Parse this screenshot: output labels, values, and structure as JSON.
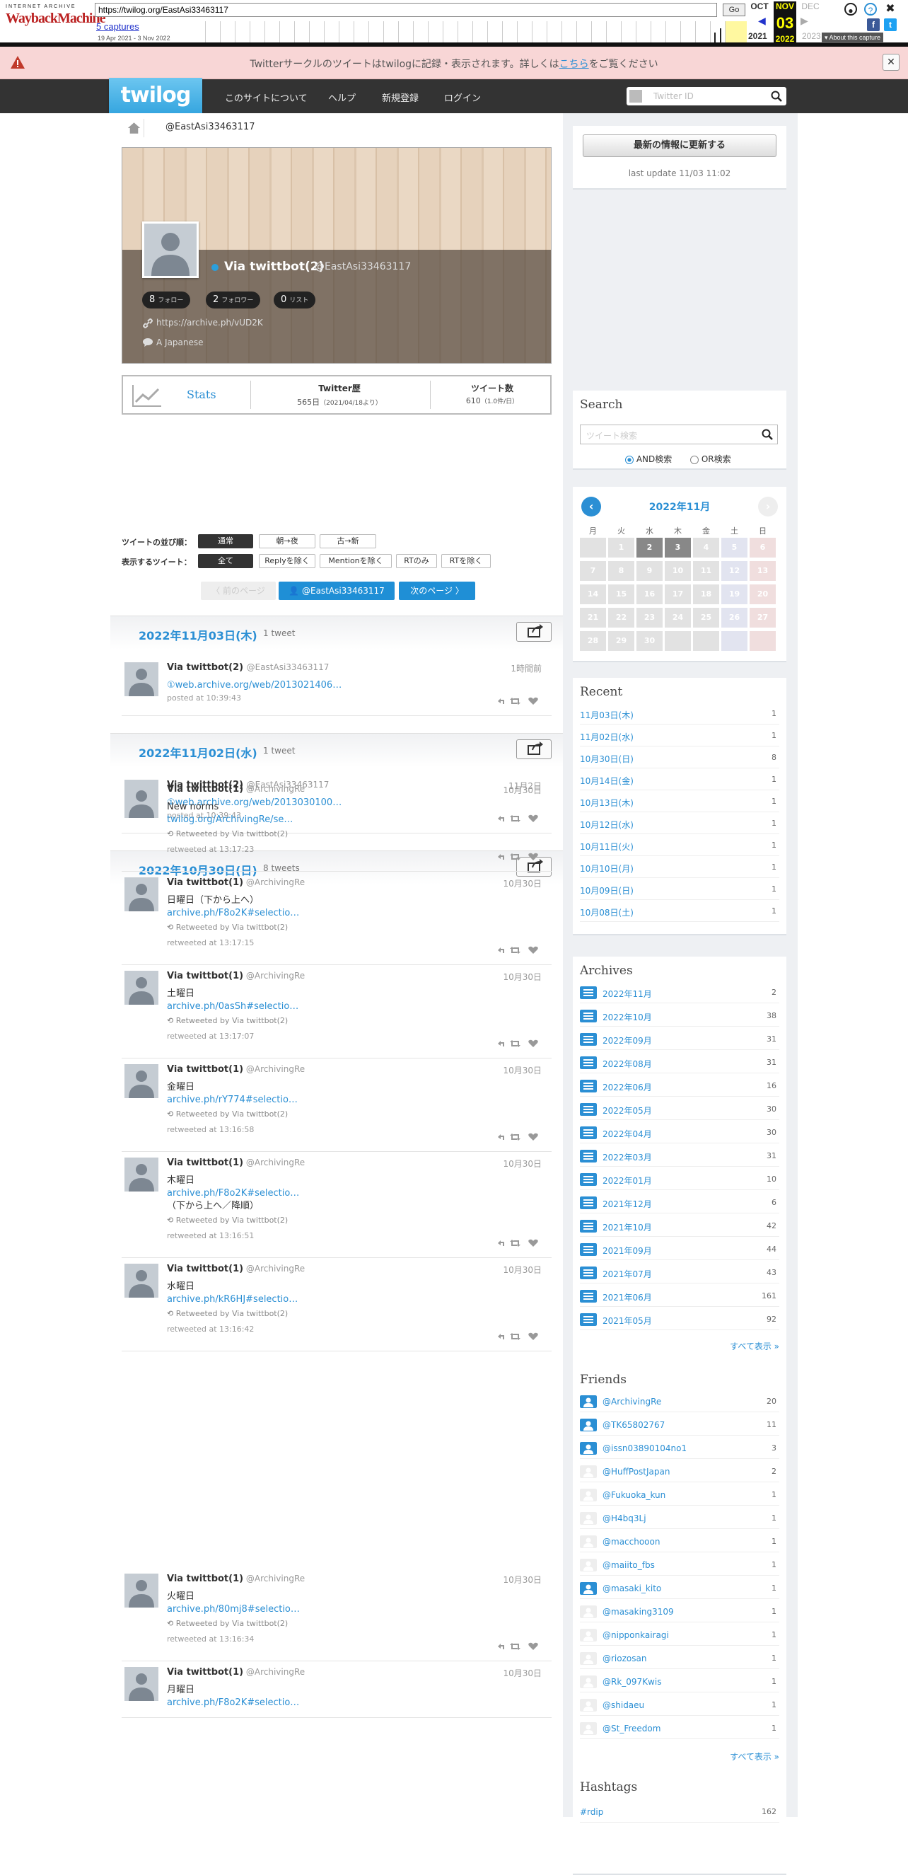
{
  "wayback": {
    "logo_top": "INTERNET ARCHIVE",
    "logo_main": "WaybackMachine",
    "url": "https://twilog.org/EastAsi33463117",
    "go": "Go",
    "captures": "5 captures",
    "range": "19 Apr 2021 - 3 Nov 2022",
    "months": {
      "prev": "OCT",
      "cur": "NOV",
      "next": "DEC"
    },
    "day": "03",
    "years": {
      "prev": "2021",
      "cur": "2022",
      "next": "2023"
    },
    "about": "▾ About this capture"
  },
  "notice": {
    "text": "Twitterサークルのツイートはtwilogに記録・表示されます。詳しくは",
    "link": "こちら",
    "suffix": "をご覧ください",
    "close": "✕"
  },
  "nav": {
    "logo": "twilog",
    "links": [
      "このサイトについて",
      "ヘルプ",
      "新規登録",
      "ログイン"
    ],
    "search_placeholder": "Twitter ID"
  },
  "breadcrumb": {
    "handle": "@EastAsi33463117"
  },
  "profile": {
    "name": "Via twittbot(2)",
    "screen_name": "@EastAsi33463117",
    "pills": [
      {
        "num": "8",
        "label": "フォロー"
      },
      {
        "num": "2",
        "label": "フォロワー"
      },
      {
        "num": "0",
        "label": "リスト"
      }
    ],
    "link": "https://archive.ph/vUD2K",
    "lang": "A Japanese"
  },
  "stats": {
    "label": "Stats",
    "history_head": "Twitter歴",
    "history_val": "565日",
    "history_sub": "（2021/04/18より）",
    "count_head": "ツイート数",
    "count_val": "610",
    "count_sub": "（1.0件/日）"
  },
  "sort": {
    "order_label": "ツイートの並び順：",
    "order_opts": [
      "通常",
      "朝→夜",
      "古→新"
    ],
    "show_label": "表示するツイート：",
    "show_opts": [
      "全て",
      "Replyを除く",
      "Mentionを除く",
      "RTのみ",
      "RTを除く"
    ]
  },
  "pager": {
    "prev": "〈 前のページ",
    "user": "@EastAsi33463117",
    "next": "次のページ 〉"
  },
  "days": [
    {
      "date": "2022年11月03日(木)",
      "count": "1 tweet"
    },
    {
      "date": "2022年11月02日(水)",
      "count": "1 tweet"
    },
    {
      "date": "2022年10月30日(日)",
      "count": "8 tweets"
    }
  ],
  "tweets": [
    {
      "name": "Via twittbot(2)",
      "sn": "@EastAsi33463117",
      "time": "1時間前",
      "text": "",
      "link": "①web.archive.org/web/2013021406…",
      "extra": "",
      "rt": "",
      "meta": "posted at 10:39:43"
    },
    {
      "name": "Via twittbot(2)",
      "sn": "@EastAsi33463117",
      "time": "11月2日",
      "text": "",
      "link": "①web.archive.org/web/2013030100…",
      "extra": "",
      "rt": "",
      "meta": "posted at 10:39:43"
    },
    {
      "name": "Via twittbot(1)",
      "sn": "@ArchivingRe",
      "time": "10月30日",
      "text": "New norms",
      "link": "twilog.org/ArchivingRe/se…",
      "extra": "",
      "rt": "Retweeted by Via twittbot(2)",
      "meta": "retweeted at 13:17:23"
    },
    {
      "name": "Via twittbot(1)",
      "sn": "@ArchivingRe",
      "time": "10月30日",
      "text": "日曜日（下から上へ）",
      "link": "archive.ph/F8o2K#selectio…",
      "extra": "",
      "rt": "Retweeted by Via twittbot(2)",
      "meta": "retweeted at 13:17:15"
    },
    {
      "name": "Via twittbot(1)",
      "sn": "@ArchivingRe",
      "time": "10月30日",
      "text": "土曜日",
      "link": "archive.ph/0asSh#selectio…",
      "extra": "",
      "rt": "Retweeted by Via twittbot(2)",
      "meta": "retweeted at 13:17:07"
    },
    {
      "name": "Via twittbot(1)",
      "sn": "@ArchivingRe",
      "time": "10月30日",
      "text": "金曜日",
      "link": "archive.ph/rY774#selectio…",
      "extra": "",
      "rt": "Retweeted by Via twittbot(2)",
      "meta": "retweeted at 13:16:58"
    },
    {
      "name": "Via twittbot(1)",
      "sn": "@ArchivingRe",
      "time": "10月30日",
      "text": "木曜日",
      "link": "archive.ph/F8o2K#selectio…",
      "extra": "（下から上へ／降順）",
      "rt": "Retweeted by Via twittbot(2)",
      "meta": "retweeted at 13:16:51"
    },
    {
      "name": "Via twittbot(1)",
      "sn": "@ArchivingRe",
      "time": "10月30日",
      "text": "水曜日",
      "link": "archive.ph/kR6HJ#selectio…",
      "extra": "",
      "rt": "Retweeted by Via twittbot(2)",
      "meta": "retweeted at 13:16:42"
    },
    {
      "name": "Via twittbot(1)",
      "sn": "@ArchivingRe",
      "time": "10月30日",
      "text": "火曜日",
      "link": "archive.ph/80mj8#selectio…",
      "extra": "",
      "rt": "Retweeted by Via twittbot(2)",
      "meta": "retweeted at 13:16:34"
    },
    {
      "name": "Via twittbot(1)",
      "sn": "@ArchivingRe",
      "time": "10月30日",
      "text": "月曜日",
      "link": "archive.ph/F8o2K#selectio…",
      "extra": "",
      "rt": "",
      "meta": ""
    }
  ],
  "side": {
    "refresh": "最新の情報に更新する",
    "last_update": "last update 11/03 11:02",
    "search_title": "Search",
    "search_placeholder": "ツイート検索",
    "and_label": "AND検索",
    "or_label": "OR検索",
    "cal_title": "2022年11月",
    "cal_days": [
      "月",
      "火",
      "水",
      "木",
      "金",
      "土",
      "日"
    ],
    "cal_nums": [
      "",
      "1",
      "2",
      "3",
      "4",
      "5",
      "6",
      "7",
      "8",
      "9",
      "10",
      "11",
      "12",
      "13",
      "14",
      "15",
      "16",
      "17",
      "18",
      "19",
      "20",
      "21",
      "22",
      "23",
      "24",
      "25",
      "26",
      "27",
      "28",
      "29",
      "30",
      "",
      "",
      "",
      ""
    ],
    "recent_title": "Recent",
    "recent": [
      {
        "d": "11月03日(木)",
        "n": "1"
      },
      {
        "d": "11月02日(水)",
        "n": "1"
      },
      {
        "d": "10月30日(日)",
        "n": "8"
      },
      {
        "d": "10月14日(金)",
        "n": "1"
      },
      {
        "d": "10月13日(木)",
        "n": "1"
      },
      {
        "d": "10月12日(水)",
        "n": "1"
      },
      {
        "d": "10月11日(火)",
        "n": "1"
      },
      {
        "d": "10月10日(月)",
        "n": "1"
      },
      {
        "d": "10月09日(日)",
        "n": "1"
      },
      {
        "d": "10月08日(土)",
        "n": "1"
      }
    ],
    "archives_title": "Archives",
    "archives": [
      {
        "d": "2022年11月",
        "n": "2"
      },
      {
        "d": "2022年10月",
        "n": "38"
      },
      {
        "d": "2022年09月",
        "n": "31"
      },
      {
        "d": "2022年08月",
        "n": "31"
      },
      {
        "d": "2022年06月",
        "n": "16"
      },
      {
        "d": "2022年05月",
        "n": "30"
      },
      {
        "d": "2022年04月",
        "n": "30"
      },
      {
        "d": "2022年03月",
        "n": "31"
      },
      {
        "d": "2022年01月",
        "n": "10"
      },
      {
        "d": "2021年12月",
        "n": "6"
      },
      {
        "d": "2021年10月",
        "n": "42"
      },
      {
        "d": "2021年09月",
        "n": "44"
      },
      {
        "d": "2021年07月",
        "n": "43"
      },
      {
        "d": "2021年06月",
        "n": "161"
      },
      {
        "d": "2021年05月",
        "n": "92"
      }
    ],
    "show_all": "すべて表示 »",
    "friends_title": "Friends",
    "friends": [
      {
        "d": "@ArchivingRe",
        "n": "20",
        "on": true
      },
      {
        "d": "@TK65802767",
        "n": "11",
        "on": true
      },
      {
        "d": "@issn03890104no1",
        "n": "3",
        "on": true
      },
      {
        "d": "@HuffPostJapan",
        "n": "2",
        "on": false
      },
      {
        "d": "@Fukuoka_kun",
        "n": "1",
        "on": false
      },
      {
        "d": "@H4bq3Lj",
        "n": "1",
        "on": false
      },
      {
        "d": "@macchooon",
        "n": "1",
        "on": false
      },
      {
        "d": "@maiito_fbs",
        "n": "1",
        "on": false
      },
      {
        "d": "@masaki_kito",
        "n": "1",
        "on": true
      },
      {
        "d": "@masaking3109",
        "n": "1",
        "on": false
      },
      {
        "d": "@nipponkairagi",
        "n": "1",
        "on": false
      },
      {
        "d": "@riozosan",
        "n": "1",
        "on": false
      },
      {
        "d": "@Rk_097Kwis",
        "n": "1",
        "on": false
      },
      {
        "d": "@shidaeu",
        "n": "1",
        "on": false
      },
      {
        "d": "@St_Freedom",
        "n": "1",
        "on": false
      }
    ],
    "hashtags_title": "Hashtags",
    "hashtag_first": "#rdip",
    "hashtag_first_n": "162"
  },
  "colors": {
    "accent": "#2b8fd4",
    "nav": "#333333",
    "blue_button": "#1f8fd6"
  }
}
